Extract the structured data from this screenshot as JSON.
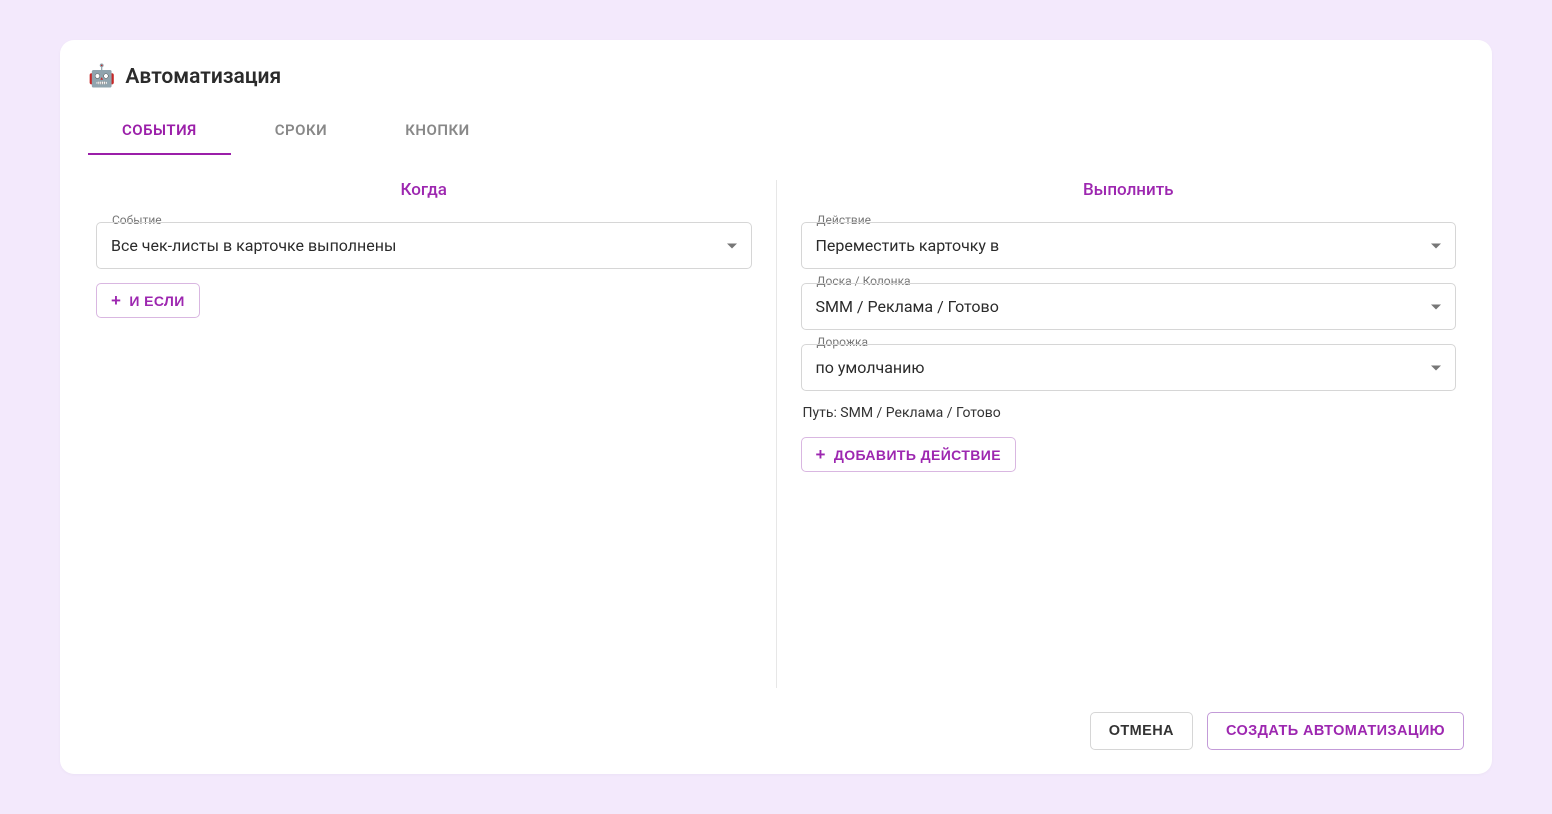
{
  "header": {
    "icon": "🤖",
    "title": "Автоматизация"
  },
  "tabs": [
    {
      "label": "СОБЫТИЯ",
      "active": true
    },
    {
      "label": "СРОКИ",
      "active": false
    },
    {
      "label": "КНОПКИ",
      "active": false
    }
  ],
  "when": {
    "heading": "Когда",
    "event": {
      "legend": "Событие",
      "value": "Все чек-листы в карточке выполнены"
    },
    "add_condition_label": "И ЕСЛИ"
  },
  "do": {
    "heading": "Выполнить",
    "action": {
      "legend": "Действие",
      "value": "Переместить карточку в"
    },
    "board_column": {
      "legend": "Доска / Колонка",
      "value": "SMM / Реклама  / Готово"
    },
    "lane": {
      "legend": "Дорожка",
      "value": "по умолчанию"
    },
    "path_text": "Путь: SMM / Реклама / Готово",
    "add_action_label": "ДОБАВИТЬ ДЕЙСТВИЕ"
  },
  "footer": {
    "cancel": "ОТМЕНА",
    "create": "СОЗДАТЬ АВТОМАТИЗАЦИЮ"
  }
}
